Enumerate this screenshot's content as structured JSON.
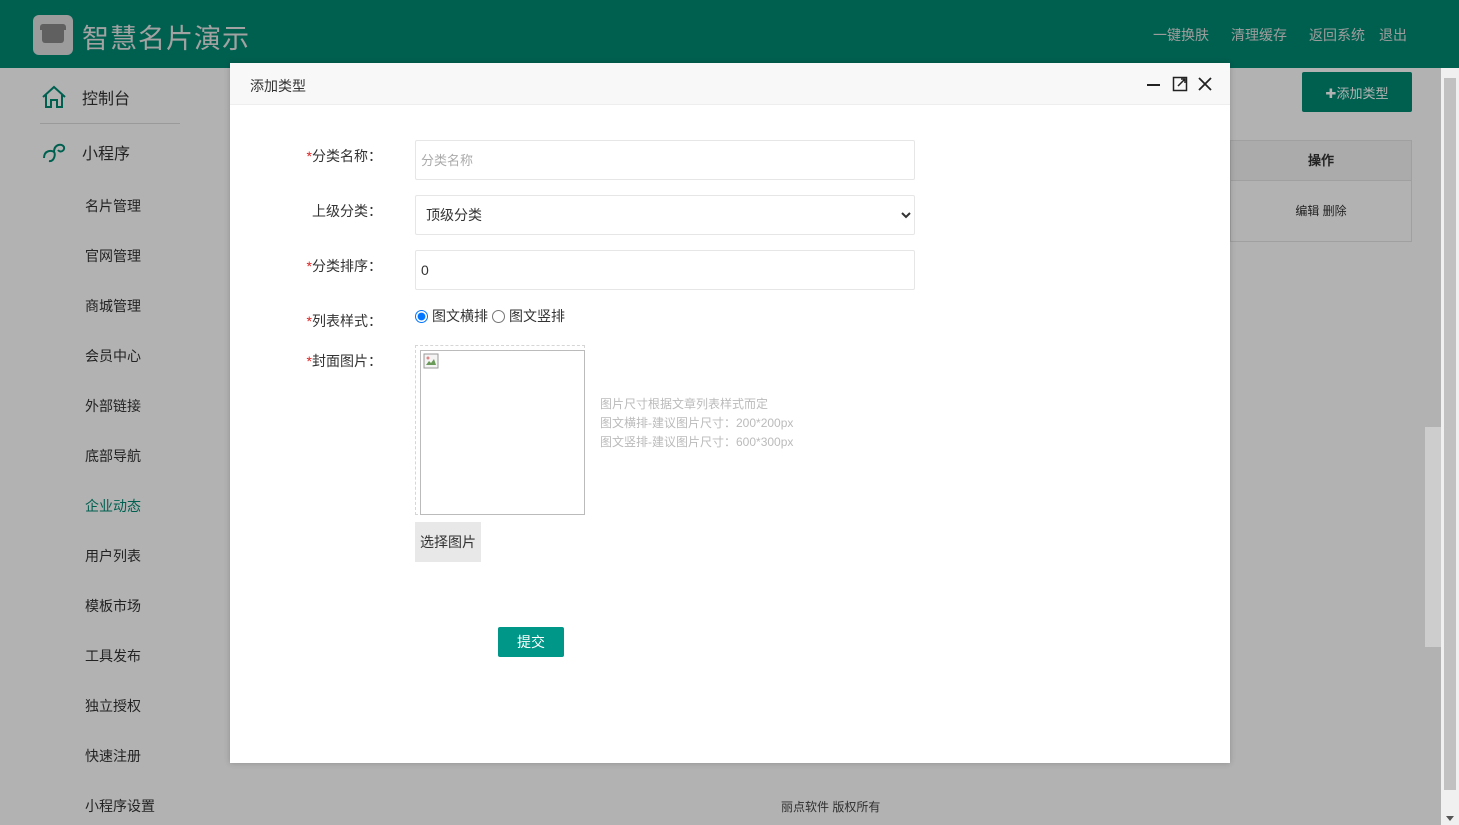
{
  "header": {
    "app_title": "智慧名片演示",
    "links": [
      "一键换肤",
      "清理缓存",
      "返回系统",
      "退出"
    ]
  },
  "sidebar": {
    "console_label": "控制台",
    "miniprogram_label": "小程序",
    "items": [
      {
        "label": "名片管理",
        "active": false
      },
      {
        "label": "官网管理",
        "active": false
      },
      {
        "label": "商城管理",
        "active": false
      },
      {
        "label": "会员中心",
        "active": false
      },
      {
        "label": "外部链接",
        "active": false
      },
      {
        "label": "底部导航",
        "active": false
      },
      {
        "label": "企业动态",
        "active": true
      },
      {
        "label": "用户列表",
        "active": false
      },
      {
        "label": "模板市场",
        "active": false
      },
      {
        "label": "工具发布",
        "active": false
      },
      {
        "label": "独立授权",
        "active": false
      },
      {
        "label": "快速注册",
        "active": false
      },
      {
        "label": "小程序设置",
        "active": false
      }
    ]
  },
  "background_page": {
    "add_type_button": "✚添加类型",
    "table_header": "操作",
    "row_actions": "编辑 删除",
    "footer": "丽点软件 版权所有"
  },
  "modal": {
    "title": "添加类型",
    "form": {
      "name_label": "分类名称：",
      "name_placeholder": "分类名称",
      "name_value": "",
      "parent_label": "上级分类：",
      "parent_selected": "顶级分类",
      "sort_label": "分类排序：",
      "sort_value": "0",
      "style_label": "列表样式：",
      "style_options": [
        "图文横排",
        "图文竖排"
      ],
      "style_selected": "图文横排",
      "cover_label": "封面图片：",
      "cover_hint": [
        "图片尺寸根据文章列表样式而定",
        "图文横排-建议图片尺寸：200*200px",
        "图文竖排-建议图片尺寸：600*300px"
      ],
      "choose_image_button": "选择图片",
      "submit_button": "提交"
    }
  },
  "colors": {
    "brand": "#008a73",
    "submit": "#009688",
    "required": "#e02020"
  }
}
